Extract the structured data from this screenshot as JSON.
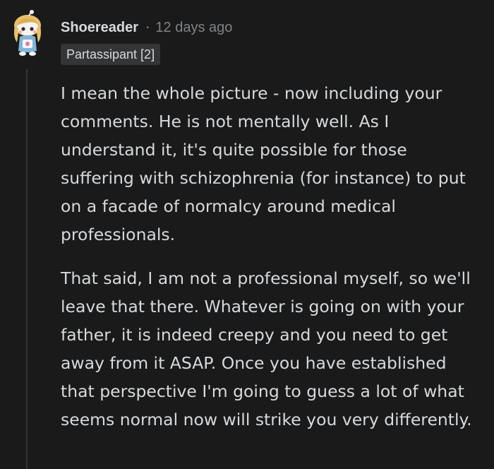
{
  "comment": {
    "username": "Shoereader",
    "separator": "·",
    "timestamp": "12 days ago",
    "flair": "Partassipant [2]",
    "avatar_icon": "snoo-avatar-icon",
    "paragraphs": [
      "I mean the whole picture - now including your comments. He is not mentally well. As I understand it, it's quite possible for those suffering with schizophrenia (for instance) to put on a facade of normalcy around medical professionals.",
      "That said, I am not a professional myself, so we'll leave that there. Whatever is going on with your father, it is indeed creepy and you need to get away from it ASAP. Once you have established that perspective I'm going to guess a lot of what seems normal now will strike you very differently."
    ]
  }
}
